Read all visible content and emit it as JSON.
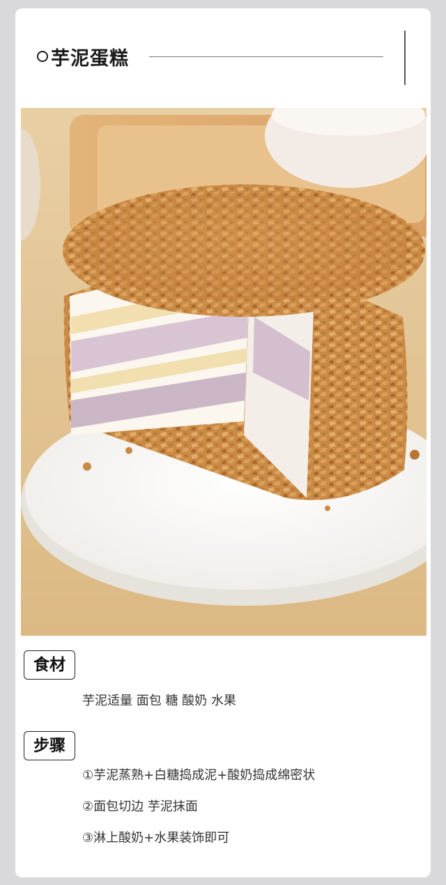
{
  "recipe": {
    "title": "芋泥蛋糕",
    "photo_subject": "taro-cake",
    "ingredients_heading": "食材",
    "ingredients": "芋泥适量 面包 糖 酸奶 水果",
    "steps_heading": "步骤",
    "steps": [
      "①芋泥蒸熟+白糖捣成泥+酸奶捣成绵密状",
      "②面包切边 芋泥抹面",
      "③淋上酸奶+水果装饰即可"
    ]
  },
  "colors": {
    "page_bg": "#d9d9dc",
    "card_bg": "#ffffff",
    "text": "#1a1a1a",
    "crust": "#c98a45",
    "cream": "#fbf6ee",
    "taro": "#c7b3c4"
  }
}
